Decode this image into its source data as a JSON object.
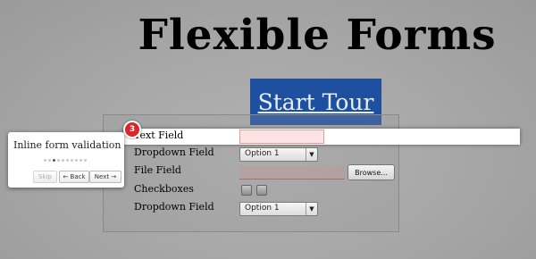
{
  "page": {
    "title": "Flexible Forms"
  },
  "tour": {
    "start_label": "Start Tour"
  },
  "form": {
    "text_field_label": "Text Field",
    "dropdown1_label": "Dropdown Field",
    "dropdown1_value": "Option 1",
    "file_field_label": "File Field",
    "browse_label": "Browse...",
    "checkboxes_label": "Checkboxes",
    "dropdown2_label": "Dropdown Field",
    "dropdown2_value": "Option 1"
  },
  "popover": {
    "step_number": "3",
    "title": "Inline form validation",
    "total_steps": 10,
    "current_step": 3,
    "skip_label": "Skip",
    "back_label": "← Back",
    "next_label": "Next →"
  },
  "colors": {
    "tour_button": "#1f4f9f",
    "badge": "#d9262a",
    "invalid_field": "#fde4e4"
  }
}
